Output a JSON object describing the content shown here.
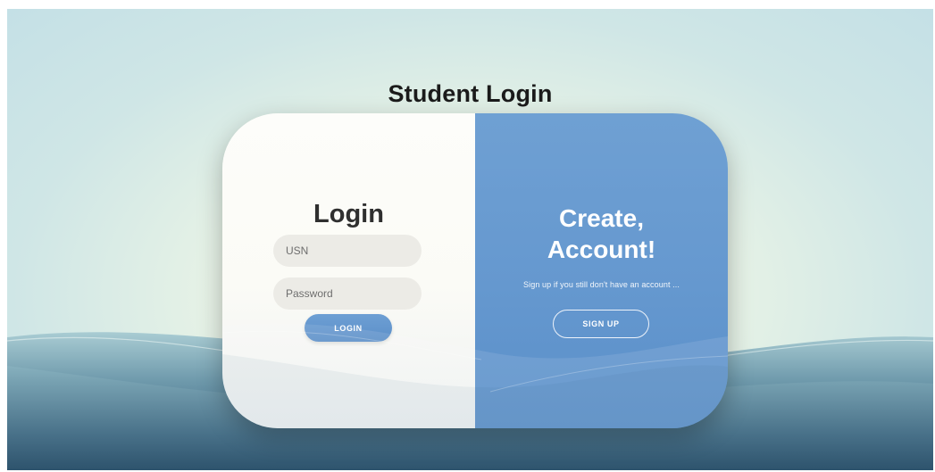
{
  "page": {
    "title": "Student Login"
  },
  "login_panel": {
    "heading": "Login",
    "usn_placeholder": "USN",
    "password_placeholder": "Password",
    "login_label": "LOGIN"
  },
  "signup_panel": {
    "heading_line1": "Create,",
    "heading_line2": "Account!",
    "subtitle": "Sign up if you still don't have an account ...",
    "signup_label": "SIGN UP"
  },
  "colors": {
    "accent_blue": "#6598cf",
    "title_text": "#1b1b1b",
    "field_bg": "#ecebe6"
  }
}
